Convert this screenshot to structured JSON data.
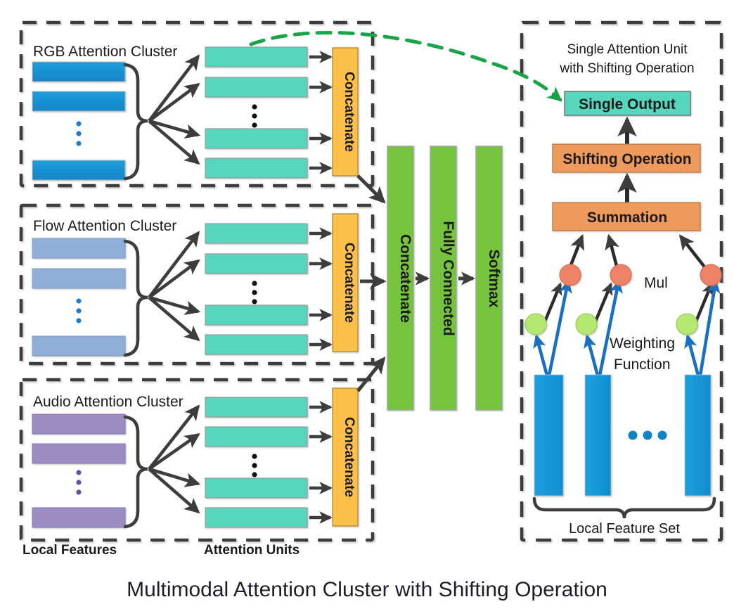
{
  "figure": {
    "title": "Multimodal Attention Cluster with Shifting Operation"
  },
  "clusters": [
    {
      "id": "rgb",
      "label": "RGB Attention Cluster",
      "feature_color": "#1797d8",
      "concatenate_label": "Concatenate",
      "attention_unit_color": "#54d6bd",
      "feature_count_shown": 3,
      "attention_units_shown": 4,
      "ellipsis": "vertical-dots"
    },
    {
      "id": "flow",
      "label": "Flow Attention Cluster",
      "feature_color": "#8fafd8",
      "concatenate_label": "Concatenate",
      "attention_unit_color": "#54d6bd",
      "feature_count_shown": 3,
      "attention_units_shown": 4,
      "ellipsis": "vertical-dots"
    },
    {
      "id": "audio",
      "label": "Audio Attention Cluster",
      "feature_color": "#9b8cc4",
      "concatenate_label": "Concatenate",
      "attention_unit_color": "#54d6bd",
      "feature_count_shown": 3,
      "attention_units_shown": 4,
      "ellipsis": "vertical-dots"
    }
  ],
  "column_labels": {
    "local_features": "Local Features",
    "attention_units": "Attention Units"
  },
  "fusion_blocks": [
    {
      "id": "concatenate",
      "label": "Concatenate"
    },
    {
      "id": "fully-connected",
      "label": "Fully Connected"
    },
    {
      "id": "softmax",
      "label": "Softmax"
    }
  ],
  "detail_panel": {
    "title_line1": "Single Attention Unit",
    "title_line2": "with Shifting Operation",
    "single_output": "Single Output",
    "shifting_operation": "Shifting Operation",
    "summation": "Summation",
    "mul": "Mul",
    "weighting_function_line1": "Weighting",
    "weighting_function_line2": "Function",
    "local_feature_set": "Local Feature Set",
    "feature_bars_shown": 3,
    "mul_nodes_shown": 3,
    "weight_nodes_shown": 3,
    "ellipsis": "horizontal-dots"
  },
  "colors": {
    "blue_feature": "#1797d8",
    "blue_feature_dark": "#1283c2",
    "flow_feature": "#8fafd8",
    "audio_feature": "#9b8cc4",
    "teal_unit": "#54d6bd",
    "orange_concat": "#fcbf49",
    "green_block": "#76c43c",
    "orange_op": "#ed9a5c",
    "mul_node": "#ee8266",
    "weight_node": "#b4e870",
    "arrow_dark": "#3d3d3d",
    "arrow_blue": "#1b6fc0",
    "dashed_green": "#1aa449",
    "dashed_border": "#3d3d3d",
    "title_text": "#1d1d2b"
  }
}
